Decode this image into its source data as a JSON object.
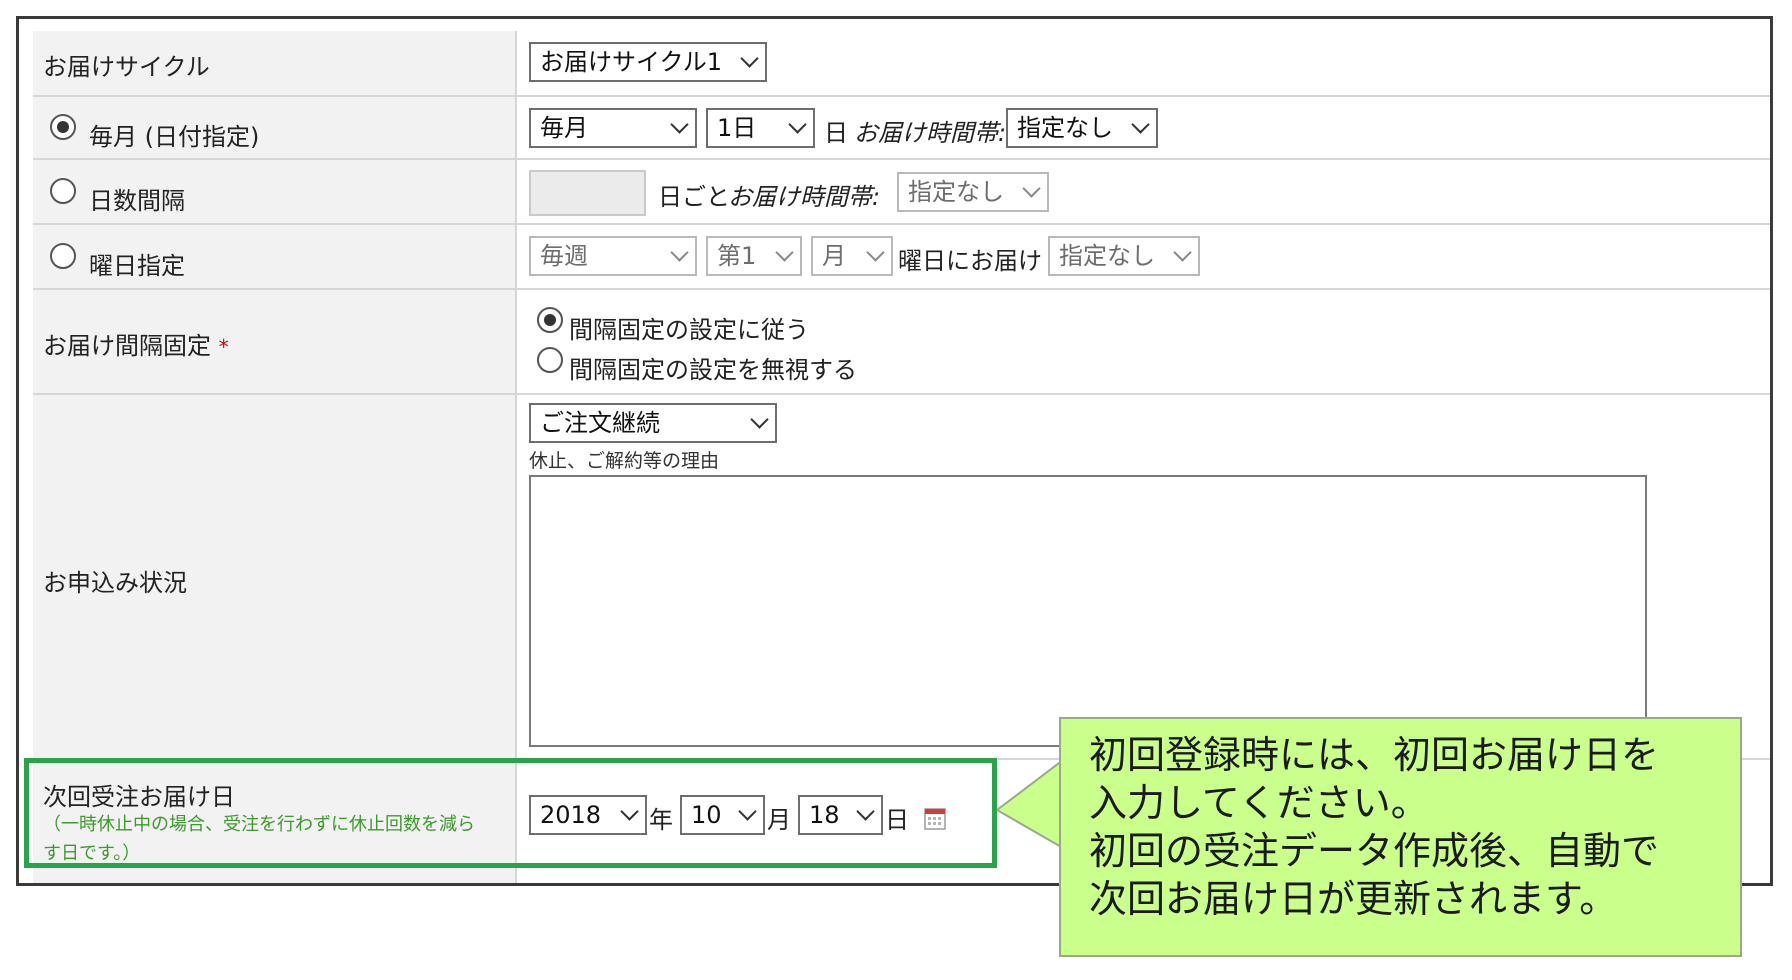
{
  "rows": {
    "cycle": {
      "label": "お届けサイクル",
      "select": "お届けサイクル1"
    },
    "monthly": {
      "label": "毎月 (日付指定)",
      "month_select": "毎月",
      "day_select": "1日",
      "day_suffix": "日",
      "time_label": "お届け時間帯:",
      "time_select": "指定なし"
    },
    "interval": {
      "label": "日数間隔",
      "suffix": "日ごと",
      "time_label": "お届け時間帯:",
      "time_select": "指定なし"
    },
    "weekday": {
      "label": "曜日指定",
      "week_select": "毎週",
      "nth_select": "第1",
      "dow_select": "月",
      "mid_text": "曜日にお届け",
      "time_select": "指定なし"
    },
    "fixed": {
      "label": "お届け間隔固定",
      "required_mark": "*",
      "option_follow": "間隔固定の設定に従う",
      "option_ignore": "間隔固定の設定を無視する"
    },
    "status": {
      "label": "お申込み状況",
      "select": "ご注文継続",
      "reason_label": "休止、ご解約等の理由",
      "reason_value": ""
    },
    "next_date": {
      "label": "次回受注お届け日",
      "note_line1": "（一時休止中の場合、受注を行わずに休止回数を減ら",
      "note_line2": "す日です。）",
      "year_select": "2018",
      "year_suffix": "年",
      "month_select": "10",
      "month_suffix": "月",
      "day_select": "18",
      "day_suffix": "日"
    }
  },
  "callout": {
    "line1": "初回登録時には、初回お届け日を",
    "line2": "入力してください。",
    "line3": "初回の受注データ作成後、自動で",
    "line4": "次回お届け日が更新されます。"
  },
  "colors": {
    "highlight_border": "#2aa34a",
    "callout_bg": "#c9ff8a",
    "required": "#d40000",
    "note": "#3c9a2d"
  }
}
